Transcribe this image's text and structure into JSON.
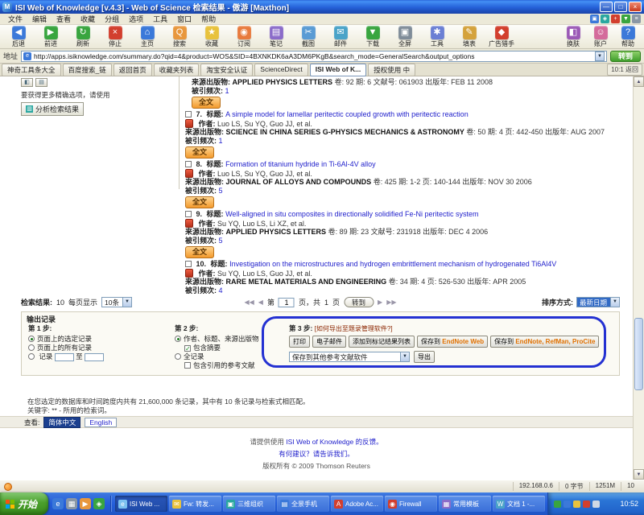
{
  "window": {
    "title": "ISI Web of Knowledge [v.4.3] - Web of Science 检索结果 - 傲游 [Maxthon]",
    "controls": [
      {
        "name": "minimize-button",
        "glyph": "—"
      },
      {
        "name": "maximize-button",
        "glyph": "□"
      },
      {
        "name": "close-button",
        "glyph": "×"
      }
    ]
  },
  "menu": {
    "items": [
      "文件",
      "编辑",
      "查看",
      "收藏",
      "分组",
      "选项",
      "工具",
      "窗口",
      "帮助"
    ],
    "right_icons": [
      {
        "name": "menu-blue-icon",
        "color": "#3b79d9",
        "glyph": "▣"
      },
      {
        "name": "menu-teal-icon",
        "color": "#2aa7a0",
        "glyph": "◈"
      },
      {
        "name": "menu-red-icon",
        "color": "#d23f2e",
        "glyph": "+"
      },
      {
        "name": "menu-green-icon",
        "color": "#39a53f",
        "glyph": "▼"
      },
      {
        "name": "menu-gray-icon",
        "color": "#8a97a5",
        "glyph": "≡"
      }
    ]
  },
  "toolbar": {
    "items": [
      {
        "name": "back",
        "label": "后退",
        "glyph": "◀",
        "color": "#3b79d9"
      },
      {
        "name": "forward",
        "label": "前进",
        "glyph": "▶",
        "color": "#39a53f"
      },
      {
        "name": "refresh",
        "label": "刷新",
        "glyph": "↻",
        "color": "#39a53f"
      },
      {
        "name": "stop",
        "label": "停止",
        "glyph": "×",
        "color": "#d23f2e"
      },
      {
        "name": "home",
        "label": "主页",
        "glyph": "⌂",
        "color": "#3b79d9"
      },
      {
        "name": "search",
        "label": "搜索",
        "glyph": "Q",
        "color": "#e8973d"
      },
      {
        "name": "favorites",
        "label": "收藏",
        "glyph": "★",
        "color": "#e8c23d"
      },
      {
        "name": "rss",
        "label": "订阅",
        "glyph": "◉",
        "color": "#e87a3d"
      },
      {
        "name": "notes",
        "label": "笔记",
        "glyph": "▤",
        "color": "#8b6cc9"
      },
      {
        "name": "snapshot",
        "label": "截图",
        "glyph": "✂",
        "color": "#5a9bd4"
      },
      {
        "name": "mail",
        "label": "邮件",
        "glyph": "✉",
        "color": "#4aa3c8"
      },
      {
        "name": "download",
        "label": "下载",
        "glyph": "▼",
        "color": "#39a53f"
      },
      {
        "name": "fullscreen",
        "label": "全屏",
        "glyph": "▣",
        "color": "#7f8c99"
      },
      {
        "name": "tools",
        "label": "工具",
        "glyph": "✱",
        "color": "#6b7fd4"
      },
      {
        "name": "autofill",
        "label": "填表",
        "glyph": "✎",
        "color": "#d4a23c"
      },
      {
        "name": "adhunter",
        "label": "广告猎手",
        "glyph": "◆",
        "color": "#d23f2e"
      }
    ],
    "right_items": [
      {
        "name": "skin",
        "label": "换肤",
        "glyph": "◧",
        "color": "#9b59b6"
      },
      {
        "name": "account",
        "label": "账户",
        "glyph": "☺",
        "color": "#d46b9b"
      },
      {
        "name": "help",
        "label": "帮助",
        "glyph": "?",
        "color": "#3b79d9"
      }
    ]
  },
  "address": {
    "label": "地址",
    "url": "http://apps.isiknowledge.com/summary.do?qid=4&product=WOS&SID=4BXNKDK6aA3DM6PKgB&search_mode=GeneralSearch&output_options",
    "go": "转到"
  },
  "favbar": {
    "tabs": [
      {
        "label": "神奇工具条大全",
        "active": false
      },
      {
        "label": "百度搜索_链",
        "active": false
      },
      {
        "label": "返回首页",
        "active": false
      },
      {
        "label": "收藏夹列表",
        "active": false
      },
      {
        "label": "淘宝安全认证",
        "active": false
      },
      {
        "label": "ScienceDirect",
        "active": false
      },
      {
        "label": "ISI Web of K...",
        "active": true
      },
      {
        "label": "授权使用 中",
        "active": false
      }
    ],
    "right_label": "10:1 返回"
  },
  "sidebar": {
    "hint": "要获得更多精确选项，请使用",
    "analyze_button": "分析检索结果"
  },
  "results": {
    "labels": {
      "title": "标题:",
      "authors": "作者:",
      "source": "来源出版物:",
      "cited": "被引频次:",
      "fulltext": "全文"
    },
    "partial": {
      "journal": "APPLIED PHYSICS LETTERS",
      "detail": "卷: 92  期: 6  文献号: 061903  出版年: FEB 11 2008",
      "cited": "1"
    },
    "records": [
      {
        "num": "7.",
        "title": "A simple model for lamellar peritectic coupled growth with peritectic reaction",
        "authors": "Luo LS, Su YQ, Guo JJ, et al.",
        "journal": "SCIENCE IN CHINA SERIES G-PHYSICS MECHANICS & ASTRONOMY",
        "detail": "卷: 50  期: 4  页: 442-450  出版年: AUG 2007",
        "cited": "1"
      },
      {
        "num": "8.",
        "title": "Formation of titanium hydride in Ti-6Al-4V alloy",
        "authors": "Luo LS, Su YQ, Guo JJ, et al.",
        "journal": "JOURNAL OF ALLOYS AND COMPOUNDS",
        "detail": "卷: 425  期: 1-2  页: 140-144  出版年: NOV 30 2006",
        "cited": "5"
      },
      {
        "num": "9.",
        "title": "Well-aligned in situ composites in directionally solidified Fe-Ni peritectic system",
        "authors": "Su YQ, Luo LS, Li XZ, et al.",
        "journal": "APPLIED PHYSICS LETTERS",
        "detail": "卷: 89  期: 23  文献号: 231918  出版年: DEC 4 2006",
        "cited": "5"
      },
      {
        "num": "10.",
        "title": "Investigation on the microstructures and hydrogen embrittlement mechanism of hydrogenated Ti6Al4V",
        "authors": "Su YQ, Luo LS, Guo JJ, et al.",
        "journal": "RARE METAL MATERIALS AND ENGINEERING",
        "detail": "卷: 34  期: 4  页: 526-530  出版年: APR 2005",
        "cited": "4"
      }
    ]
  },
  "resultbar": {
    "count_label": "检索结果:",
    "count": "10",
    "per_page_label": "每页显示",
    "per_page": "10条",
    "first": "◀◀",
    "prev": "◀",
    "page_pre": "第",
    "page": "1",
    "page_mid": "页，共",
    "pages": "1",
    "page_post": "页",
    "goto": "转到",
    "next": "▶",
    "last": "▶▶",
    "sort_label": "排序方式:",
    "sort_value": "最新日期"
  },
  "output": {
    "title": "输出记录",
    "step1": {
      "label": "第 1 步:",
      "opt_selected": "页面上的选定记录",
      "opt_all": "页面上的所有记录",
      "range_pre": "记录",
      "range_mid": "至"
    },
    "step2": {
      "label": "第 2 步:",
      "opt1": "作者、标题、来源出版物",
      "opt1_sub": "包含摘要",
      "opt2": "全记录",
      "opt3": "包含引用的参考文献"
    },
    "step3": {
      "label": "第 3 步:",
      "hint": "[如何导出至题录管理软件?]",
      "print": "打印",
      "email": "电子邮件",
      "marklist": "添加到标记结果列表",
      "save_pre": "保存到",
      "endnote_web": "EndNote Web",
      "endnote_desktop": "EndNote, RefMan, ProCite",
      "other_select": "保存到其他参考文献软件",
      "export": "导出"
    },
    "highlight_color": "#2431d2"
  },
  "footer": {
    "summary": "在您选定的数据库和时间跨度内共有 21,600,000 条记录，其中有 10 条记录与检索式相匹配。",
    "keyword_note": "关键字: ** - 所用的检索词。",
    "lang_label": "查看:",
    "lang_zh": "简体中文",
    "lang_en": "English",
    "feedback_pre": "请提供使用 ",
    "feedback_link": "ISI Web of Knowledge 的反馈。",
    "suggestion": "有何建议？请告诉我们。",
    "copyright": "版权所有 © 2009 Thomson Reuters"
  },
  "statusbar": {
    "cells": [
      "192.168.0.6",
      "0 字节",
      "1251M",
      "10"
    ]
  },
  "taskbar": {
    "start": "开始",
    "quick": [
      {
        "name": "quicklaunch-ie-icon",
        "color": "#3b79d9",
        "glyph": "e"
      },
      {
        "name": "quicklaunch-desktop-icon",
        "color": "#8a97a5",
        "glyph": "▦"
      },
      {
        "name": "quicklaunch-media-icon",
        "color": "#e8973d",
        "glyph": "▶"
      },
      {
        "name": "quicklaunch-msn-icon",
        "color": "#39a53f",
        "glyph": "◈"
      }
    ],
    "buttons": [
      {
        "label": "ISI Web ...",
        "color": "#7cc2f0",
        "glyph": "e",
        "active": true
      },
      {
        "label": "Fw: 转发...",
        "color": "#e8c23d",
        "glyph": "✉",
        "active": false
      },
      {
        "label": "三维组织",
        "color": "#2aa7a0",
        "glyph": "▣",
        "active": false
      },
      {
        "label": "全景手机",
        "color": "#3b79d9",
        "glyph": "▤",
        "active": false
      },
      {
        "label": "Adobe Ac...",
        "color": "#d23f2e",
        "glyph": "A",
        "active": false
      },
      {
        "label": "Firewall",
        "color": "#d23f2e",
        "glyph": "◉",
        "active": false
      },
      {
        "label": "常用模板",
        "color": "#8b6cc9",
        "glyph": "▦",
        "active": false
      },
      {
        "label": "文档 1 -...",
        "color": "#4aa3c8",
        "glyph": "W",
        "active": false
      }
    ],
    "tray_icons": [
      {
        "name": "tray-antivirus-icon",
        "color": "#39a53f"
      },
      {
        "name": "tray-network-icon",
        "color": "#3b79d9"
      },
      {
        "name": "tray-volume-icon",
        "color": "#e8c23d"
      },
      {
        "name": "tray-alert-icon",
        "color": "#d23f2e"
      },
      {
        "name": "tray-system-icon",
        "color": "#cfd8e4"
      }
    ],
    "clock": "10:52"
  }
}
